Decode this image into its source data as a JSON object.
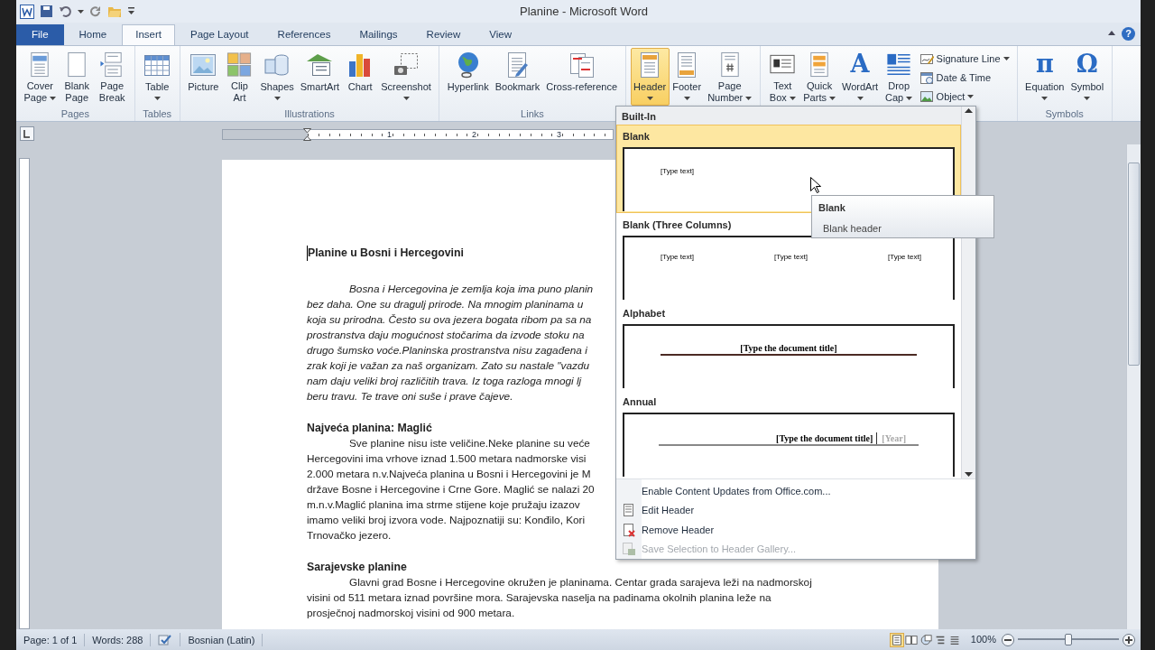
{
  "window": {
    "title": "Planine - Microsoft Word",
    "help": "?"
  },
  "tabs": [
    {
      "label": "File",
      "kind": "file",
      "selected": false
    },
    {
      "label": "Home",
      "kind": "tab",
      "selected": false
    },
    {
      "label": "Insert",
      "kind": "tab",
      "selected": true
    },
    {
      "label": "Page Layout",
      "kind": "tab",
      "selected": false
    },
    {
      "label": "References",
      "kind": "tab",
      "selected": false
    },
    {
      "label": "Mailings",
      "kind": "tab",
      "selected": false
    },
    {
      "label": "Review",
      "kind": "tab",
      "selected": false
    },
    {
      "label": "View",
      "kind": "tab",
      "selected": false
    }
  ],
  "ribbon": {
    "groups": [
      {
        "label": "Pages",
        "buttons": [
          {
            "kind": "large",
            "lines": [
              "Cover",
              "Page"
            ],
            "menu": true,
            "pressed": false
          },
          {
            "kind": "large",
            "lines": [
              "Blank",
              "Page"
            ],
            "menu": false,
            "pressed": false
          },
          {
            "kind": "large",
            "lines": [
              "Page",
              "Break"
            ],
            "menu": false,
            "pressed": false
          }
        ]
      },
      {
        "label": "Tables",
        "buttons": [
          {
            "kind": "large",
            "lines": [
              "Table"
            ],
            "menu": true,
            "pressed": false
          }
        ]
      },
      {
        "label": "Illustrations",
        "buttons": [
          {
            "kind": "large",
            "lines": [
              "Picture"
            ],
            "menu": false,
            "pressed": false
          },
          {
            "kind": "large",
            "lines": [
              "Clip",
              "Art"
            ],
            "menu": false,
            "pressed": false
          },
          {
            "kind": "large",
            "lines": [
              "Shapes"
            ],
            "menu": true,
            "pressed": false
          },
          {
            "kind": "large",
            "lines": [
              "SmartArt"
            ],
            "menu": false,
            "pressed": false
          },
          {
            "kind": "large",
            "lines": [
              "Chart"
            ],
            "menu": false,
            "pressed": false
          },
          {
            "kind": "large",
            "lines": [
              "Screenshot"
            ],
            "menu": true,
            "pressed": false
          }
        ]
      },
      {
        "label": "Links",
        "buttons": [
          {
            "kind": "large",
            "lines": [
              "Hyperlink"
            ],
            "menu": false,
            "pressed": false
          },
          {
            "kind": "large",
            "lines": [
              "Bookmark"
            ],
            "menu": false,
            "pressed": false
          },
          {
            "kind": "large",
            "lines": [
              "Cross-reference"
            ],
            "menu": false,
            "pressed": false
          }
        ]
      },
      {
        "buttons": [
          {
            "kind": "large",
            "lines": [
              "Header"
            ],
            "menu": true,
            "pressed": true
          },
          {
            "kind": "large",
            "lines": [
              "Footer"
            ],
            "menu": true,
            "pressed": false
          },
          {
            "kind": "large",
            "lines": [
              "Page",
              "Number"
            ],
            "menu": true,
            "pressed": false
          }
        ]
      },
      {
        "buttons": [
          {
            "kind": "large",
            "lines": [
              "Text",
              "Box"
            ],
            "menu": true,
            "pressed": false
          },
          {
            "kind": "large",
            "lines": [
              "Quick",
              "Parts"
            ],
            "menu": true,
            "pressed": false
          },
          {
            "kind": "large",
            "lines": [
              "WordArt"
            ],
            "glyph": "A",
            "menu": true,
            "pressed": false
          },
          {
            "kind": "large",
            "lines": [
              "Drop",
              "Cap"
            ],
            "menu": true,
            "pressed": false
          },
          {
            "kind": "small",
            "lines": [
              "Signature Line"
            ],
            "menu": true,
            "pressed": false
          },
          {
            "kind": "small",
            "lines": [
              "Date & Time"
            ],
            "menu": false,
            "pressed": false
          },
          {
            "kind": "small",
            "lines": [
              "Object"
            ],
            "menu": true,
            "pressed": false
          }
        ]
      },
      {
        "label": "Symbols",
        "buttons": [
          {
            "kind": "large",
            "lines": [
              "Equation"
            ],
            "glyph": "π",
            "menu": true,
            "pressed": false
          },
          {
            "kind": "large",
            "lines": [
              "Symbol"
            ],
            "glyph": "Ω",
            "menu": true,
            "pressed": false
          }
        ]
      }
    ]
  },
  "ruler": {
    "numbers": [
      "1",
      "2",
      "3"
    ]
  },
  "document": {
    "blocks": [
      {
        "kind": "heading",
        "text": "Planine u Bosni i Hercegovini"
      },
      {
        "kind": "paragraph",
        "italic": true,
        "lines": [
          "Bosna i Hercegovina je zemlja koja ima puno planin",
          "bez daha. One su dragulj prirode. Na mnogim planinama u",
          "koja su prirodna. Često su ova jezera bogata ribom pa sa na",
          "prostranstva daju mogućnost stočarima da izvode stoku na",
          "drugo šumsko voće.Planinska prostranstva nisu zagađena i",
          "zrak koji je važan za naš organizam. Zato su nastale \"vazdu",
          "nam daju veliki broj različitih  trava. Iz toga razloga mnogi lj",
          "beru travu. Te trave oni suše i prave čajeve."
        ]
      },
      {
        "kind": "heading",
        "text": "Najveća planina: Maglić"
      },
      {
        "kind": "paragraph",
        "italic": false,
        "lines": [
          "Sve planine nisu iste veličine.Neke planine su veće",
          "Hercegovini ima  vrhove iznad 1.500  metara nadmorske visi",
          "2.000  metara n.v.Najveća planina u Bosni i Hercegovini je M",
          "države Bosne i Hercegovine i Crne Gore. Maglić se nalazi  20",
          "m.n.v.Maglić planina ima  strme stijene koje pružaju izazov",
          "imamo veliki broj izvora vode. Najpoznatiji su: Konđilo, Kori",
          "Trnovačko jezero."
        ]
      },
      {
        "kind": "heading",
        "text": "Sarajevske planine"
      },
      {
        "kind": "paragraph",
        "italic": false,
        "lines": [
          "Glavni grad Bosne i Hercegovine okružen je planinama. Centar grada sarajeva leži na nadmorskoj",
          "visini od 511  metara iznad površine mora. Sarajevska naselja na padinama okolnih planina leže na",
          "prosječnoj nadmorskoj visini od 900  metara."
        ]
      }
    ]
  },
  "header_menu": {
    "section": "Built-In",
    "gallery": [
      {
        "title": "Blank",
        "kind": "blank",
        "selected": true,
        "texts": [
          "[Type text]"
        ]
      },
      {
        "title": "Blank (Three Columns)",
        "kind": "three_columns",
        "selected": false,
        "texts": [
          "[Type text]",
          "[Type text]",
          "[Type text]"
        ]
      },
      {
        "title": "Alphabet",
        "kind": "alphabet",
        "selected": false,
        "texts": [
          "[Type the document title]"
        ]
      },
      {
        "title": "Annual",
        "kind": "annual",
        "selected": false,
        "texts": [
          "[Type the document title]",
          "[Year]"
        ]
      }
    ],
    "commands": [
      {
        "label": "Enable Content Updates from Office.com...",
        "disabled": false
      },
      {
        "label": "Edit Header",
        "disabled": false
      },
      {
        "label": "Remove Header",
        "disabled": false
      },
      {
        "label": "Save Selection to Header Gallery...",
        "disabled": true
      }
    ]
  },
  "tooltip": {
    "title": "Blank",
    "description": "Blank header"
  },
  "status_bar": {
    "page": "Page: 1 of 1",
    "words": "Words: 288",
    "language": "Bosnian (Latin)",
    "zoom": "100%",
    "zoom_slider": {
      "level": 0.5
    },
    "views": [
      {
        "kind": "print",
        "selected": true
      },
      {
        "kind": "reading",
        "selected": false
      },
      {
        "kind": "web",
        "selected": false
      },
      {
        "kind": "outline",
        "selected": false
      },
      {
        "kind": "draft",
        "selected": false
      }
    ]
  }
}
